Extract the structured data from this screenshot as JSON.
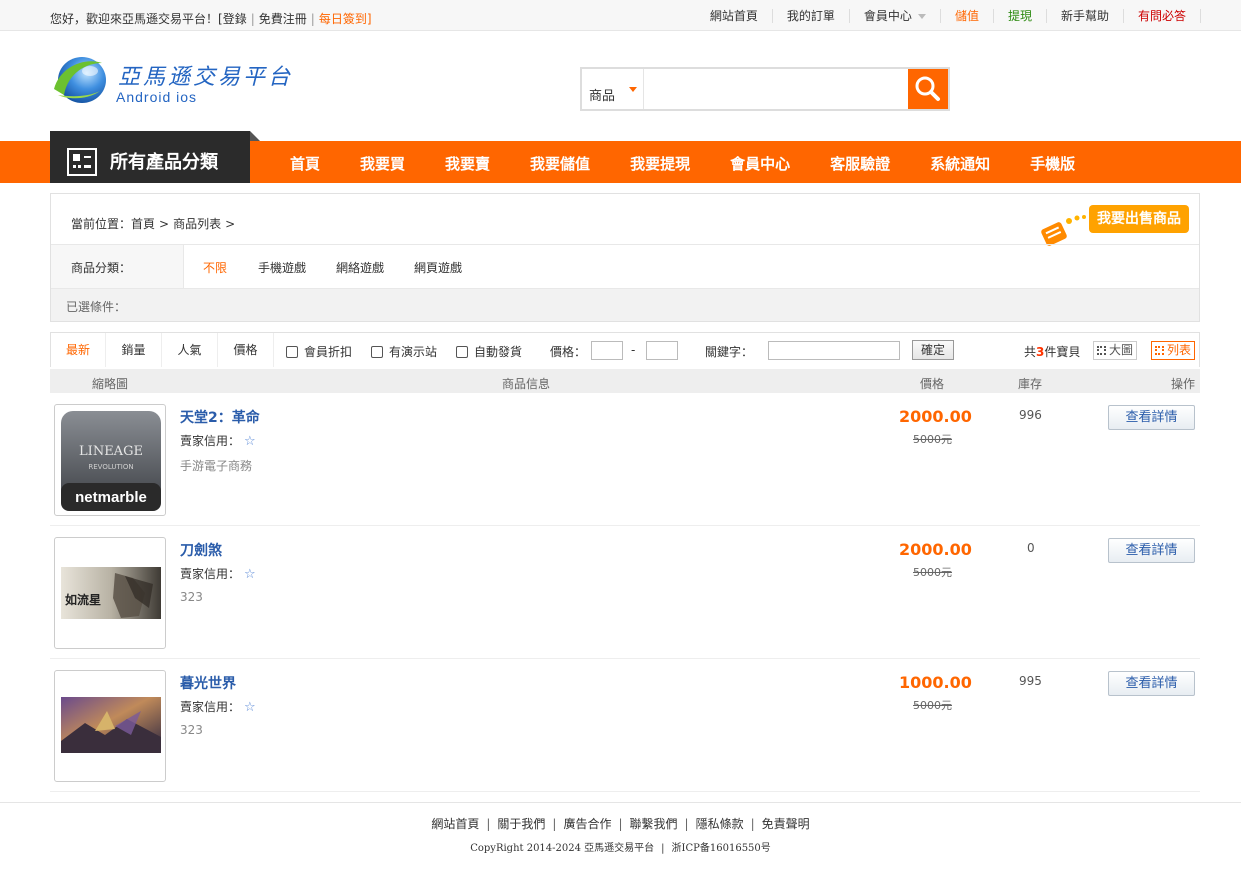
{
  "topbar": {
    "welcome": "您好，歡迎來亞馬遜交易平台！",
    "login": "[登錄",
    "register": "免費注冊",
    "checkin": "每日簽到]",
    "links": [
      {
        "label": "網站首頁",
        "color": "normal"
      },
      {
        "label": "我的訂單",
        "color": "normal"
      },
      {
        "label": "會員中心",
        "color": "normal",
        "dropdown": true
      },
      {
        "label": "儲值",
        "color": "orange"
      },
      {
        "label": "提現",
        "color": "green"
      },
      {
        "label": "新手幫助",
        "color": "normal"
      },
      {
        "label": "有問必答",
        "color": "red"
      }
    ]
  },
  "logo": {
    "name": "亞馬遜交易平台",
    "sub": "Android ios"
  },
  "search": {
    "category": "商品",
    "placeholder": "",
    "icon": "search-icon"
  },
  "nav": {
    "all_categories": "所有產品分類",
    "items": [
      "首頁",
      "我要買",
      "我要賣",
      "我要儲值",
      "我要提現",
      "會員中心",
      "客服驗證",
      "系統通知",
      "手機版"
    ]
  },
  "breadcrumb": {
    "prefix": "當前位置：",
    "items": [
      "首頁",
      "商品列表"
    ]
  },
  "sell_button": "我要出售商品",
  "filter": {
    "label": "商品分類：",
    "options": [
      "不限",
      "手機遊戲",
      "網絡遊戲",
      "網頁遊戲"
    ],
    "selected_index": 0,
    "selected_label": "已選條件："
  },
  "sortbar": {
    "sorts": [
      "最新",
      "銷量",
      "人氣",
      "價格"
    ],
    "checkboxes": [
      "會員折扣",
      "有演示站",
      "自動發貨"
    ],
    "price_label": "價格：",
    "dash": "-",
    "keyword_label": "關鍵字：",
    "confirm": "確定",
    "total_prefix": "共",
    "total_count": "3",
    "total_suffix": "件寶貝",
    "view_big": "大圖",
    "view_list": "列表"
  },
  "table_header": {
    "thumb": "縮略圖",
    "info": "商品信息",
    "price": "價格",
    "stock": "庫存",
    "action": "操作"
  },
  "products": [
    {
      "title": "天堂2：革命",
      "credit": "賣家信用：",
      "desc": "手游電子商務",
      "price": "2000.00",
      "orig": "5000元",
      "stock": "996",
      "action": "查看詳情",
      "thumb_text": [
        "LINEAGE",
        "REVOLUTION",
        "netmarble"
      ]
    },
    {
      "title": "刀劍煞",
      "credit": "賣家信用：",
      "desc": "323",
      "price": "2000.00",
      "orig": "5000元",
      "stock": "0",
      "action": "查看詳情",
      "thumb_text": [
        "如流星"
      ]
    },
    {
      "title": "暮光世界",
      "credit": "賣家信用：",
      "desc": "323",
      "price": "1000.00",
      "orig": "5000元",
      "stock": "995",
      "action": "查看詳情",
      "thumb_text": []
    }
  ],
  "footer": {
    "links": [
      "網站首頁",
      "關于我們",
      "廣告合作",
      "聯繫我們",
      "隱私條款",
      "免責聲明"
    ],
    "copyright": "CopyRight 2014-2024 亞馬遜交易平台",
    "icp": "浙ICP备16016550号"
  },
  "colors": {
    "accent": "#ff6600",
    "nav_dark": "#2b2b2b",
    "link_blue": "#2a5caa"
  }
}
